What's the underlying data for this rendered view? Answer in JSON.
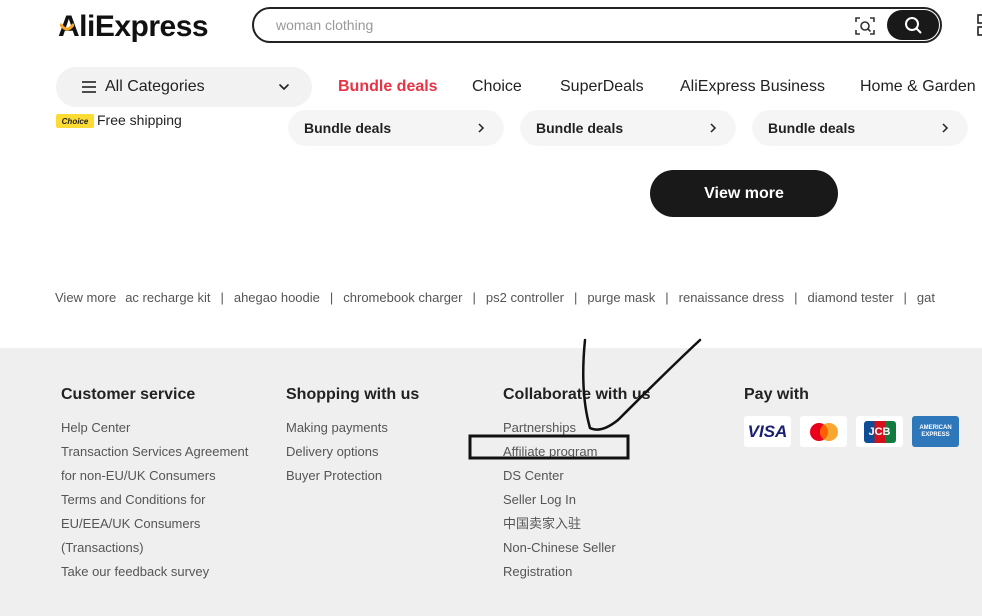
{
  "header": {
    "logo_text": "AliExpress",
    "search_placeholder": "woman clothing"
  },
  "nav": {
    "all_categories": "All Categories",
    "links": [
      "Bundle deals",
      "Choice",
      "SuperDeals",
      "AliExpress Business",
      "Home & Garden"
    ]
  },
  "promo": {
    "choice_badge": "Choice",
    "free_shipping": "Free shipping",
    "bundle_cards": [
      "Bundle deals",
      "Bundle deals",
      "Bundle deals"
    ],
    "view_more_button": "View more"
  },
  "related_searches": {
    "label": "View more",
    "terms": [
      "ac recharge kit",
      "ahegao hoodie",
      "chromebook charger",
      "ps2 controller",
      "purge mask",
      "renaissance dress",
      "diamond tester",
      "gat"
    ]
  },
  "footer": {
    "customer_service": {
      "title": "Customer service",
      "links": [
        "Help Center",
        "Transaction Services Agreement",
        "for non-EU/UK Consumers",
        "Terms and Conditions for",
        "EU/EEA/UK Consumers",
        "(Transactions)",
        "Take our feedback survey"
      ]
    },
    "shopping": {
      "title": "Shopping with us",
      "links": [
        "Making payments",
        "Delivery options",
        "Buyer Protection"
      ]
    },
    "collaborate": {
      "title": "Collaborate with us",
      "links": [
        "Partnerships",
        "Affiliate program",
        "DS Center",
        "Seller Log In",
        "中国卖家入驻",
        "Non-Chinese Seller",
        "Registration"
      ]
    },
    "pay": {
      "title": "Pay with",
      "cards": [
        "visa-icon",
        "mastercard-icon",
        "jcb-icon",
        "amex-icon"
      ],
      "visa_text": "VISA",
      "jcb_text": "JCB",
      "amex_text": "AMERICAN EXPRESS"
    }
  },
  "colors": {
    "accent_red": "#e83344",
    "dark": "#191919",
    "footer_bg": "#efefef",
    "choice_yellow": "#fddb35"
  }
}
